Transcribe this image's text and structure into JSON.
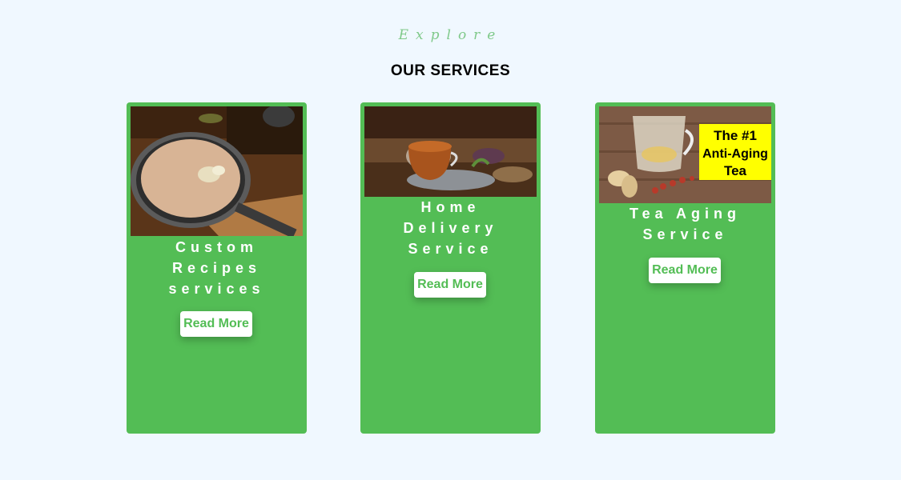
{
  "section": {
    "eyebrow": "Explore",
    "title": "OUR SERVICES"
  },
  "cards": [
    {
      "name_lines": [
        "Custom",
        "Recipes",
        "services"
      ],
      "button_label": "Read More",
      "image_icon": "masala-chai-pan-image"
    },
    {
      "name_lines": [
        "Home",
        "Delivery",
        "Service"
      ],
      "button_label": "Read More",
      "image_icon": "tea-cup-image"
    },
    {
      "name_lines": [
        "Tea Aging",
        "Service"
      ],
      "button_label": "Read More",
      "image_icon": "anti-aging-tea-image",
      "image_text_lines": [
        "The #1",
        "Anti-Aging",
        "Tea"
      ]
    }
  ],
  "colors": {
    "background": "#f0f8ff",
    "card": "#53bd55",
    "button_text": "#53bd55",
    "eyebrow": "#7fc98a"
  }
}
